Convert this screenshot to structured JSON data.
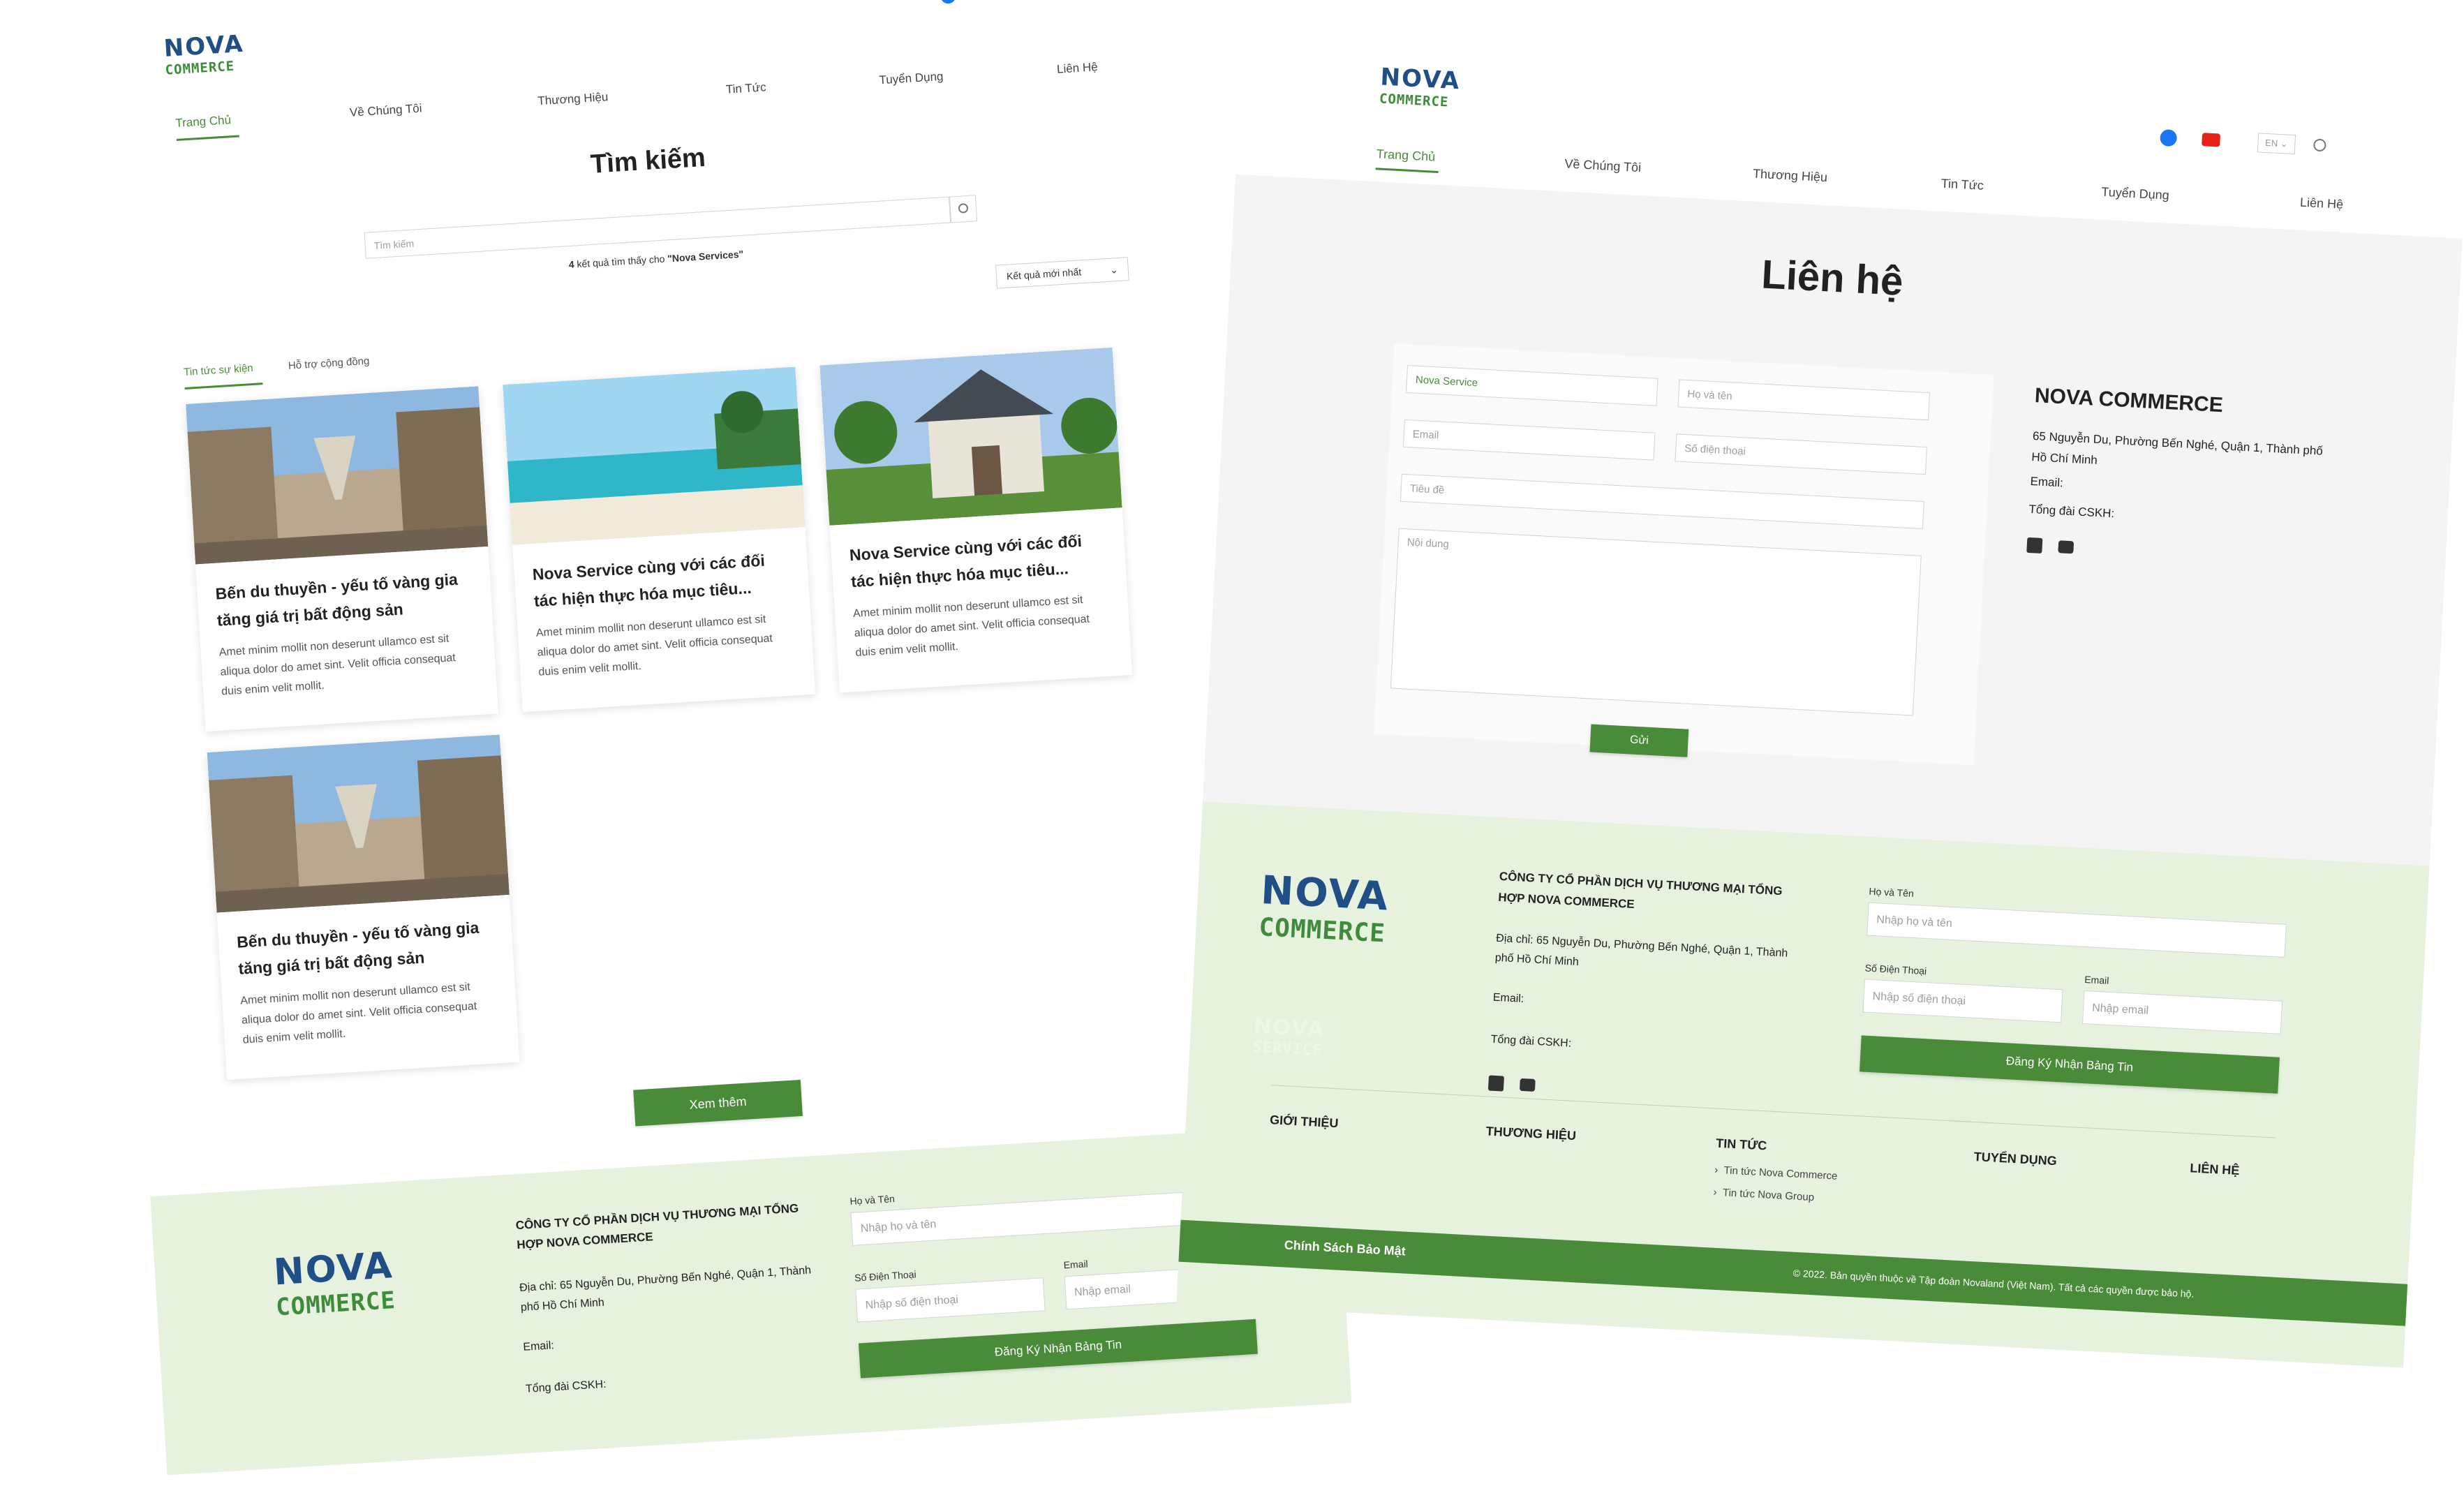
{
  "colors": {
    "brand_green": "#4a8b3a",
    "brand_blue": "#1f4f86",
    "footer_bg": "#e6f1de",
    "contact_bg": "#f4f4f4"
  },
  "brand": {
    "logo_top": "NOVA",
    "logo_bottom": "COMMERCE",
    "service_logo_top": "NOVA",
    "service_logo_bottom": "SERVICE"
  },
  "nav": {
    "items": [
      "Trang Chủ",
      "Về Chúng Tôi",
      "Thương Hiệu",
      "Tin Tức",
      "Tuyển Dụng",
      "Liên Hệ"
    ],
    "lang": "EN",
    "icons": [
      "facebook-icon",
      "youtube-icon",
      "search-icon"
    ]
  },
  "search_page": {
    "title": "Tìm kiếm",
    "search_placeholder": "Tìm kiếm",
    "result_count": "4",
    "result_text": "kết quả tìm thấy cho",
    "query": "\"Nova Services\"",
    "sort_label": "Kết quả mới nhất",
    "tabs": [
      "Tin tức sự kiện",
      "Hỗ trợ cộng đồng"
    ],
    "articles": [
      {
        "title": "Bến du thuyền - yếu tố vàng gia tăng giá trị bất động sản",
        "desc": "Amet minim mollit non deserunt ullamco est sit aliqua dolor do amet sint. Velit officia consequat duis enim velit mollit.",
        "image": "marina-street"
      },
      {
        "title": "Nova Service cùng với các đối tác hiện thực hóa mục tiêu...",
        "desc": "Amet minim mollit non deserunt ullamco est sit aliqua dolor do amet sint. Velit officia consequat duis enim velit mollit.",
        "image": "beach"
      },
      {
        "title": "Nova Service cùng với các đối tác hiện thực hóa mục tiêu...",
        "desc": "Amet minim mollit non deserunt ullamco est sit aliqua dolor do amet sint. Velit officia consequat duis enim velit mollit.",
        "image": "villa"
      },
      {
        "title": "Bến du thuyền - yếu tố vàng gia tăng giá trị bất động sản",
        "desc": "Amet minim mollit non deserunt ullamco est sit aliqua dolor do amet sint. Velit officia consequat duis enim velit mollit.",
        "image": "marina-street"
      }
    ],
    "more_button": "Xem thêm"
  },
  "contact_page": {
    "title": "Liên hệ",
    "form": {
      "company_value": "Nova Service",
      "name_placeholder": "Họ và tên",
      "email_placeholder": "Email",
      "phone_placeholder": "Số điện thoại",
      "subject_placeholder": "Tiêu đề",
      "content_placeholder": "Nội dung",
      "submit": "Gửi"
    },
    "info": {
      "company": "NOVA COMMERCE",
      "address": "65 Nguyễn Du, Phường Bến Nghé, Quận 1, Thành phố Hồ Chí Minh",
      "email_label": "Email:",
      "hotline_label": "Tổng đài CSKH:"
    }
  },
  "footer": {
    "company_name": "CÔNG TY CỔ PHẦN DỊCH VỤ THƯƠNG MẠI TỔNG HỢP NOVA COMMERCE",
    "address": "Địa chỉ: 65 Nguyễn Du, Phường Bến Nghé, Quận 1, Thành phố Hồ Chí Minh",
    "email_label": "Email:",
    "hotline_label": "Tổng đài CSKH:",
    "name_label": "Họ và Tên",
    "name_placeholder": "Nhập họ và tên",
    "phone_label": "Số Điện Thoại",
    "phone_placeholder": "Nhập số điện thoại",
    "email_field_label": "Email",
    "email_placeholder": "Nhập email",
    "subscribe": "Đăng Ký Nhận Bảng Tin",
    "nav": [
      "GIỚI THIỆU",
      "THƯƠNG HIỆU",
      "TIN TỨC",
      "TUYỂN DỤNG",
      "LIÊN HỆ"
    ],
    "news_links": [
      "Tin tức Nova Commerce",
      "Tin tức Nova Group"
    ],
    "privacy": "Chính Sách Bảo Mật",
    "copyright": "© 2022. Bản quyền thuộc về Tập đoàn Novaland (Việt Nam). Tất cả các quyền được bảo hộ."
  }
}
